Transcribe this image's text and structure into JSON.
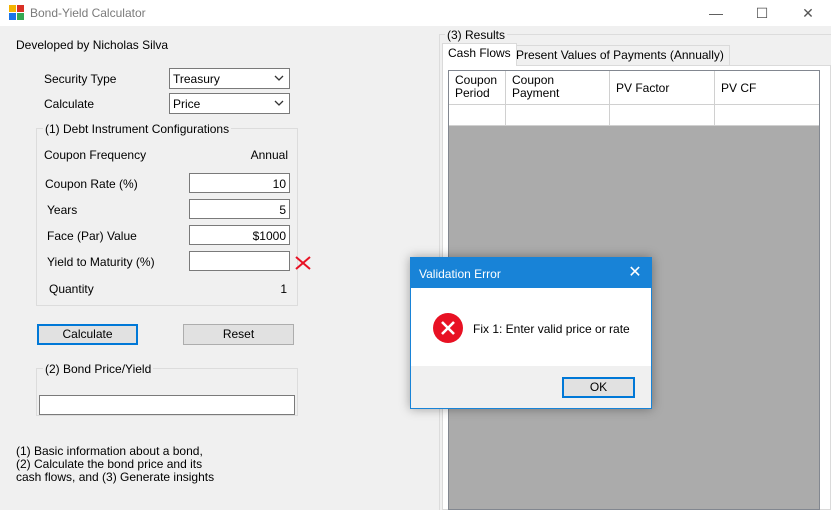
{
  "window": {
    "title": "Bond-Yield Calculator",
    "minimize": "—",
    "maximize": "☐",
    "close": "✕"
  },
  "credit": "Developed by Nicholas Silva",
  "inputs": {
    "security_type_label": "Security Type",
    "security_type_value": "Treasury",
    "calculate_label": "Calculate",
    "calculate_value": "Price"
  },
  "config": {
    "title": "(1) Debt Instrument Configurations",
    "coupon_frequency_label": "Coupon Frequency",
    "coupon_frequency_value": "Annual",
    "coupon_rate_label": "Coupon Rate (%)",
    "coupon_rate_value": "10",
    "years_label": "Years",
    "years_value": "5",
    "face_value_label": "Face (Par) Value",
    "face_value_value": "$1000",
    "ytm_label": "Yield to Maturity (%)",
    "ytm_value": "",
    "quantity_label": "Quantity",
    "quantity_value": "1"
  },
  "buttons": {
    "calculate": "Calculate",
    "reset": "Reset"
  },
  "price_yield": {
    "title": "(2) Bond Price/Yield",
    "value": ""
  },
  "notes": {
    "line1": "(1) Basic information about a bond,",
    "line2": "(2) Calculate the bond price and its",
    "line3": "cash flows, and (3) Generate insights"
  },
  "results": {
    "title": "(3) Results",
    "tabs": [
      "Cash Flows",
      "Present Values of Payments (Annually)"
    ],
    "columns": [
      {
        "line1": "Coupon",
        "line2": "Period"
      },
      {
        "line1": "Coupon",
        "line2": "Payment"
      },
      {
        "line1": "PV Factor",
        "line2": ""
      },
      {
        "line1": "PV CF",
        "line2": ""
      }
    ]
  },
  "dialog": {
    "title": "Validation Error",
    "message": "Fix 1: Enter valid price or rate",
    "ok": "OK",
    "close": "✕"
  },
  "colors": {
    "accent": "#0078d7",
    "dialog_title": "#1883d7",
    "error_red": "#e81123",
    "grid_background": "#ababab"
  }
}
